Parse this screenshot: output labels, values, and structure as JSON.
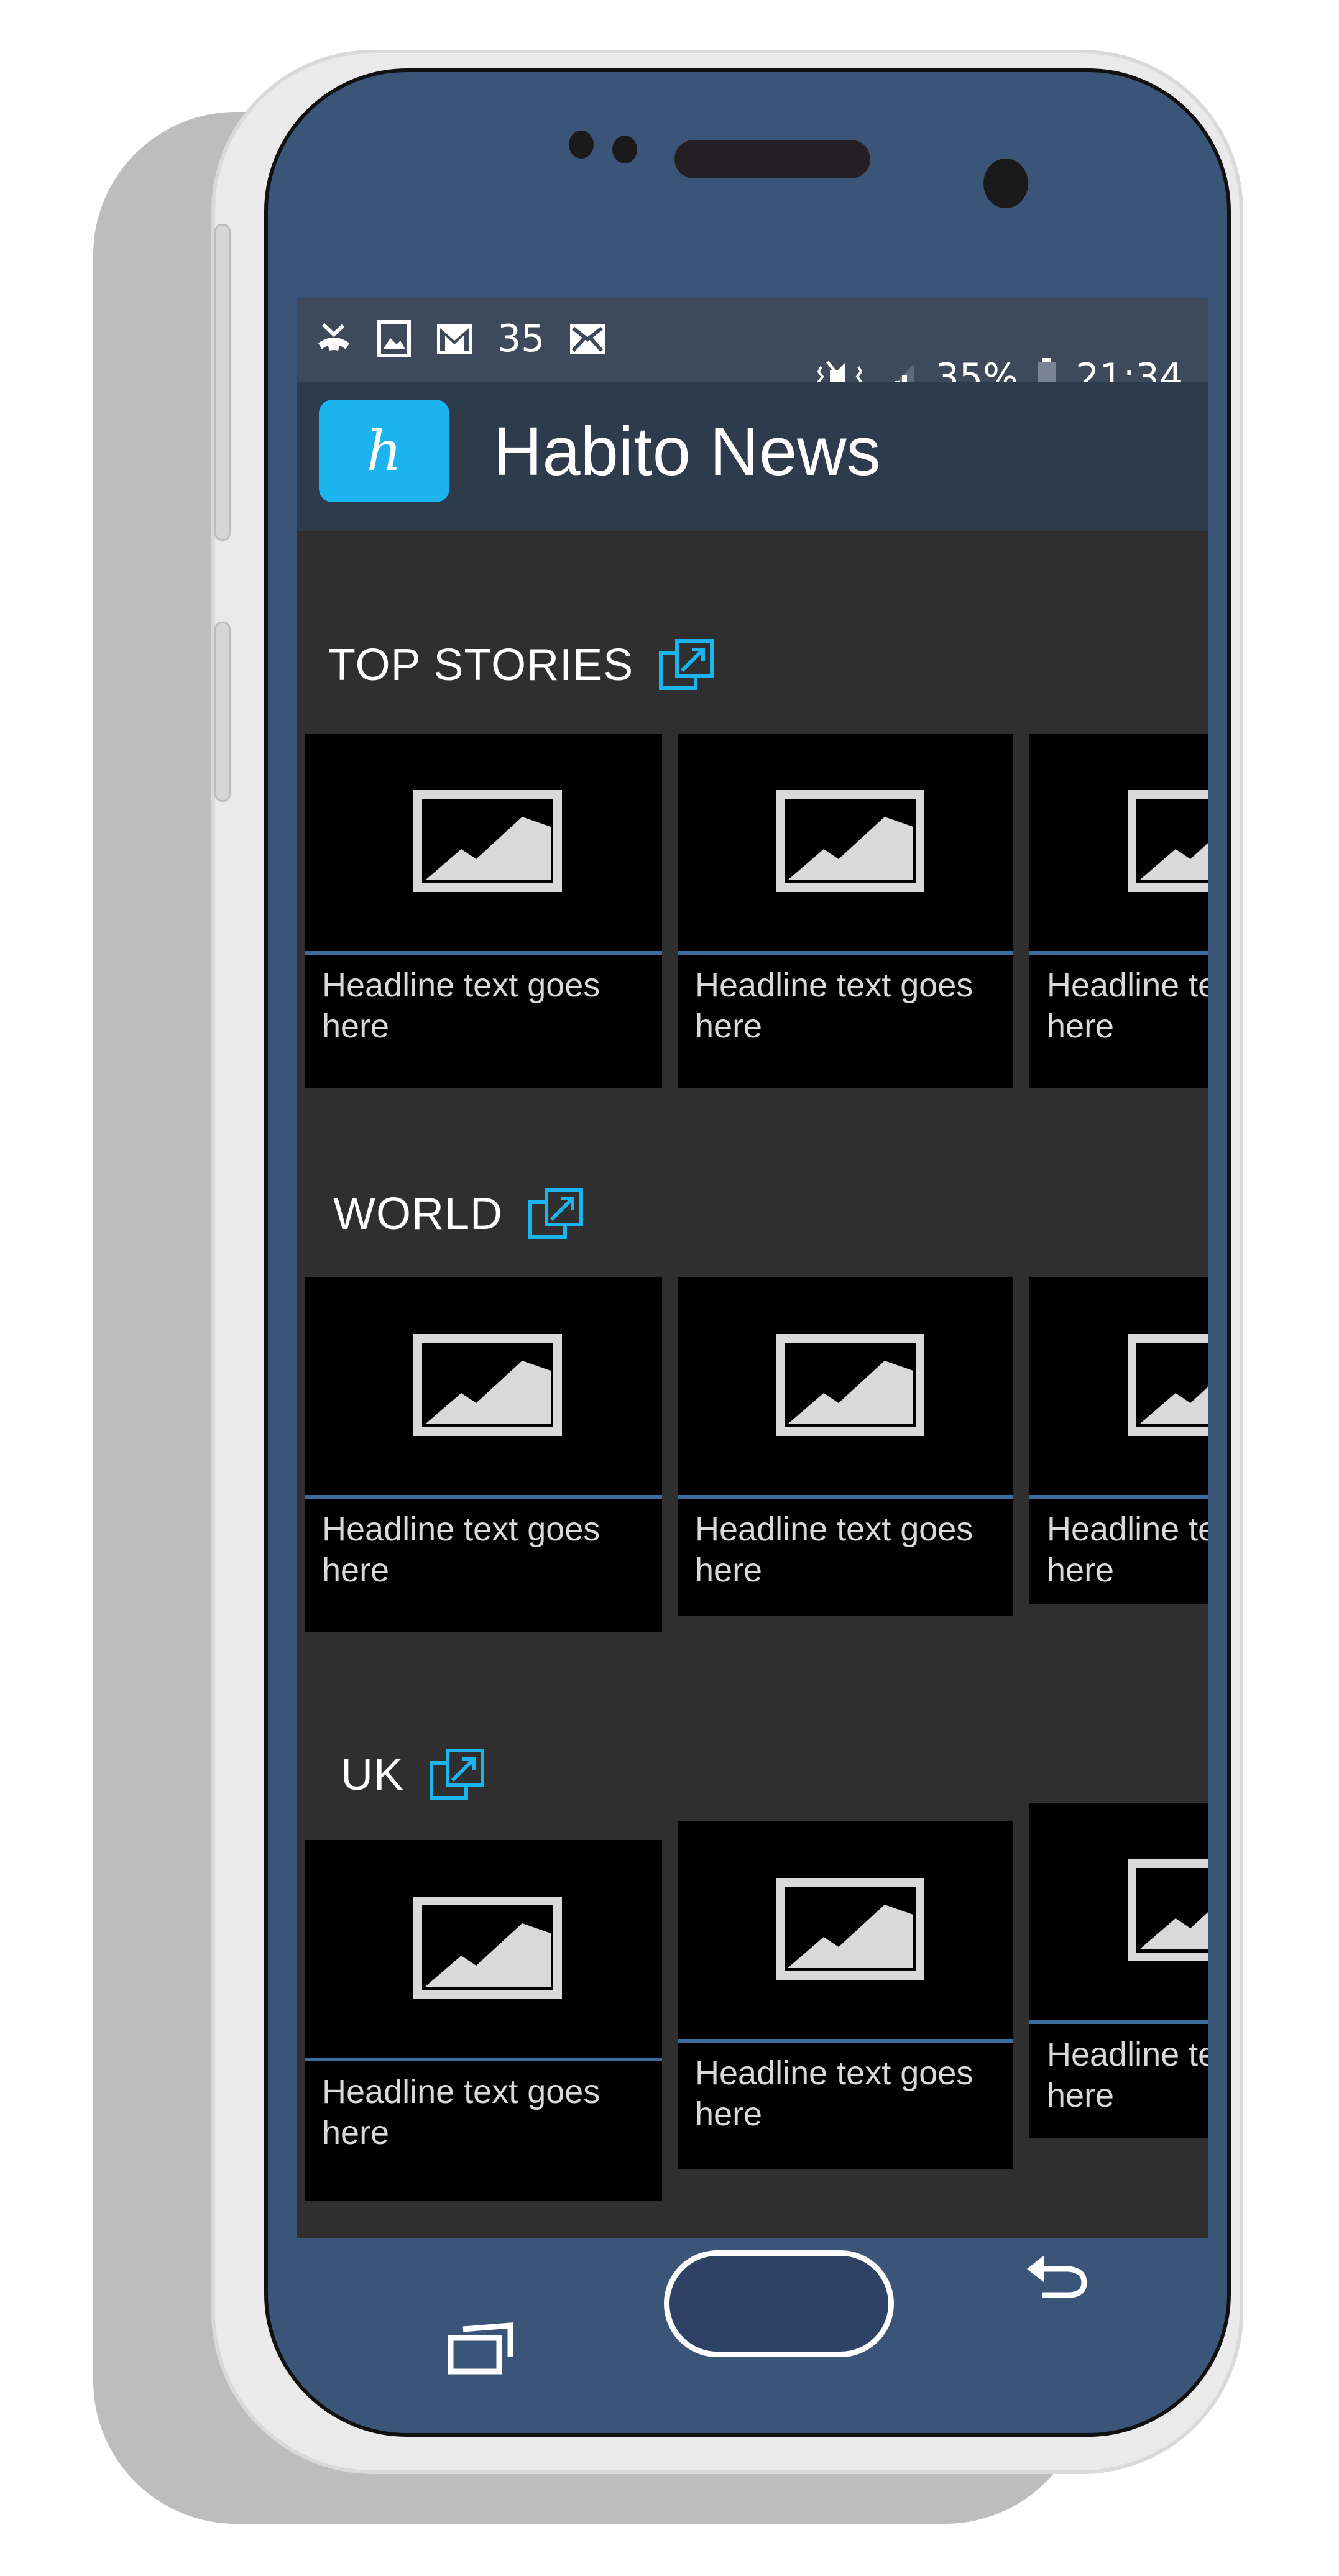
{
  "status_bar": {
    "notification_count": "35",
    "battery_percent": "35%",
    "time": "21:34",
    "icons_left": [
      "missed-call-icon",
      "gallery-icon",
      "gmail-icon",
      "email-icon"
    ],
    "icons_right": [
      "vibrate-icon",
      "signal-icon",
      "battery-icon"
    ]
  },
  "app": {
    "logo_letter": "h",
    "title": "Habito News",
    "accent_color": "#1cb4ef"
  },
  "sections": [
    {
      "title": "TOP STORIES",
      "cards": [
        {
          "headline": "Headline text goes here"
        },
        {
          "headline": "Headline text goes here"
        },
        {
          "headline": "Headline text goes here"
        }
      ]
    },
    {
      "title": "WORLD",
      "cards": [
        {
          "headline": "Headline text goes here"
        },
        {
          "headline": "Headline text goes here"
        },
        {
          "headline": "Headline text goes here"
        }
      ]
    },
    {
      "title": "UK",
      "cards": [
        {
          "headline": "Headline text goes here"
        },
        {
          "headline": "Headline text goes here"
        },
        {
          "headline": "Headline text goes here"
        }
      ]
    }
  ],
  "nav_bar": {
    "buttons": [
      "recent-apps",
      "home",
      "back"
    ]
  }
}
